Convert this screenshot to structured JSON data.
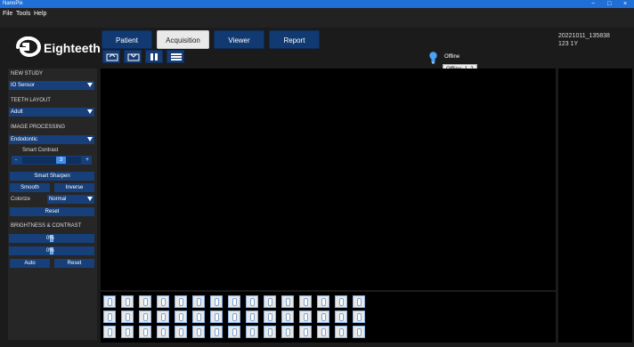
{
  "window": {
    "title": "NanoPix",
    "controls": [
      "−",
      "□",
      "×"
    ]
  },
  "menu": {
    "items": [
      "File",
      "Tools",
      "Help"
    ]
  },
  "brand": {
    "name": "Eighteeth"
  },
  "tabs": [
    {
      "label": "Patient",
      "active": false
    },
    {
      "label": "Acquisition",
      "active": true
    },
    {
      "label": "Viewer",
      "active": false
    },
    {
      "label": "Report",
      "active": false
    }
  ],
  "toolbar": {
    "icons": [
      "import-icon",
      "export-icon",
      "columns-icon",
      "list-icon"
    ]
  },
  "patient": {
    "id": "20221011_135838",
    "info": "123 1Y"
  },
  "status": {
    "label": "Offline",
    "tooltip": "Offline: 1, 2",
    "color": "#4aa3f7"
  },
  "sidebar": {
    "new_study": {
      "title": "NEW STUDY",
      "value": "IO Sensor"
    },
    "teeth_layout": {
      "title": "TEETH LAYOUT",
      "value": "Adult"
    },
    "image_processing": {
      "title": "IMAGE PROCESSING",
      "value": "Endodontic",
      "smart_contrast_label": "Smart Contrast",
      "smart_contrast_value": "3",
      "minus": "-",
      "plus": "+",
      "smart_sharpen": "Smart Sharpen",
      "smooth": "Smooth",
      "inverse": "Inverse",
      "colorize_label": "Colorize",
      "colorize_value": "Normal",
      "reset": "Reset"
    },
    "brightness_contrast": {
      "title": "BRIGHTNESS & CONTRAST",
      "brightness_value": "0%",
      "contrast_value": "0%",
      "auto": "Auto",
      "reset": "Reset"
    }
  },
  "colors": {
    "accent": "#1f6fd6",
    "button": "#173f7a",
    "panel": "#262626"
  },
  "thumbnail_grid": {
    "rows": 3,
    "columns": 15
  }
}
